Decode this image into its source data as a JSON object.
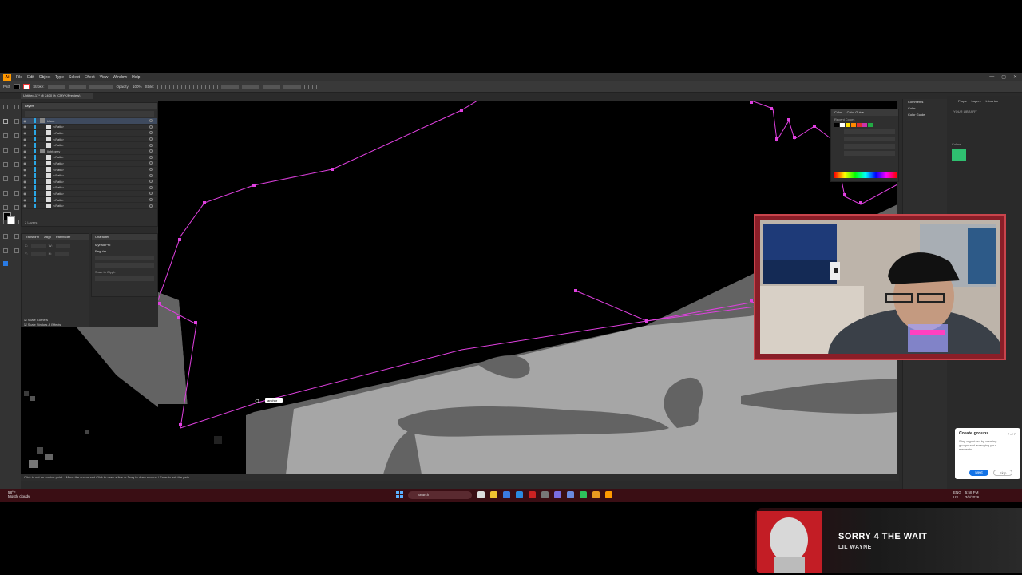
{
  "app": {
    "logo": "Ai",
    "menu": [
      "File",
      "Edit",
      "Object",
      "Type",
      "Select",
      "Effect",
      "View",
      "Window",
      "Help"
    ],
    "window_controls": [
      "—",
      "▢",
      "✕"
    ],
    "control_bar": {
      "tool_label": "Path",
      "stroke_label": "Stroke:",
      "opacity_label": "Opacity:",
      "opacity_value": "100%",
      "style_label": "Style:"
    },
    "document_tab": "Untitled-17* @ 2400 % (CMYK/Preview)"
  },
  "layers_panel": {
    "title": "Layers",
    "rows": [
      {
        "label": "black",
        "type": "layer",
        "selected": true
      },
      {
        "label": "<Path>",
        "type": "item"
      },
      {
        "label": "<Path>",
        "type": "item"
      },
      {
        "label": "<Path>",
        "type": "item"
      },
      {
        "label": "<Path>",
        "type": "item"
      },
      {
        "label": "light grey",
        "type": "layer"
      },
      {
        "label": "<Path>",
        "type": "item"
      },
      {
        "label": "<Path>",
        "type": "item"
      },
      {
        "label": "<Path>",
        "type": "item"
      },
      {
        "label": "<Path>",
        "type": "item"
      },
      {
        "label": "<Path>",
        "type": "item"
      },
      {
        "label": "<Path>",
        "type": "item"
      },
      {
        "label": "<Path>",
        "type": "item"
      },
      {
        "label": "<Path>",
        "type": "item"
      },
      {
        "label": "<Path>",
        "type": "item"
      }
    ],
    "footer": "2 Layers"
  },
  "transform_panel": {
    "tabs": [
      "Transform",
      "Align",
      "Pathfinder"
    ],
    "x_label": "X:",
    "y_label": "Y:",
    "w_label": "W:",
    "h_label": "H:",
    "options": [
      "Scale Corners",
      "Scale Strokes & Effects"
    ]
  },
  "character_panel": {
    "tab": "Character",
    "font": "Myriad Pro",
    "style": "Regular",
    "snap_label": "Snap to Glyph"
  },
  "color_panel": {
    "tabs": [
      "Color",
      "Color Guide"
    ],
    "recent_label": "Recent Colors"
  },
  "right_dock": {
    "tabs": [
      "Comments",
      "Color",
      "Color Guide"
    ]
  },
  "libraries": {
    "tabs": [
      "Props",
      "Layers",
      "Libraries"
    ],
    "library_name": "YOUR LIBRARY",
    "colors_label": "Colors",
    "accent": "#2fc070"
  },
  "canvas": {
    "tooltip": "anchor",
    "path_color": "#e040e0"
  },
  "statusbar": {
    "text": "Click to set an anchor point. / Move the cursor and Click to draw a line or Drag to draw a curve / Enter to exit the path"
  },
  "popup": {
    "title": "Create groups",
    "step": "7 of 7",
    "description": "Stay organized by creating groups and arranging your elements.",
    "next": "Next",
    "skip": "Skip"
  },
  "taskbar": {
    "weather_temp": "58°F",
    "weather_desc": "Mostly cloudy",
    "search": "Search",
    "tray_lang": "ENG",
    "tray_region": "US",
    "time": "5:58 PM",
    "date": "3/5/2026"
  },
  "music": {
    "song": "SORRY 4 THE WAIT",
    "artist": "LIL WAYNE"
  }
}
